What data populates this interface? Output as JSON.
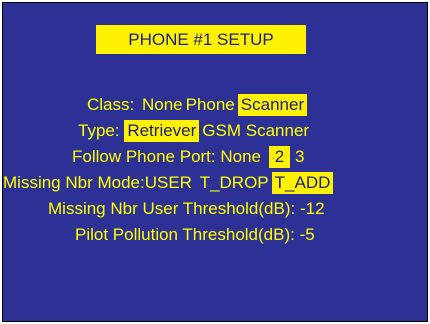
{
  "title": "PHONE #1 SETUP",
  "rows": [
    {
      "label": "Class:",
      "options": [
        {
          "text": "None",
          "selected": false
        },
        {
          "text": "Phone",
          "selected": false
        },
        {
          "text": "Scanner",
          "selected": true
        }
      ]
    },
    {
      "label": "Type:",
      "options": [
        {
          "text": "Retriever",
          "selected": true
        },
        {
          "text": "GSM Scanner",
          "selected": false
        }
      ]
    },
    {
      "label": "Follow Phone Port:",
      "options": [
        {
          "text": "None",
          "selected": false
        },
        {
          "text": "2",
          "selected": true
        },
        {
          "text": "3",
          "selected": false
        }
      ]
    },
    {
      "label": "Missing Nbr Mode:",
      "options": [
        {
          "text": "USER",
          "selected": false
        },
        {
          "text": "T_DROP",
          "selected": false
        },
        {
          "text": "T_ADD",
          "selected": true
        }
      ]
    },
    {
      "label": "Missing Nbr User Threshold(dB):",
      "value": "-12"
    },
    {
      "label": "Pilot Pollution Threshold(dB):",
      "value": "-5"
    }
  ],
  "colors": {
    "background": "#2d3195",
    "text": "#ffff00",
    "highlight": "#fff200",
    "highlight_text": "#1a1f8a"
  }
}
